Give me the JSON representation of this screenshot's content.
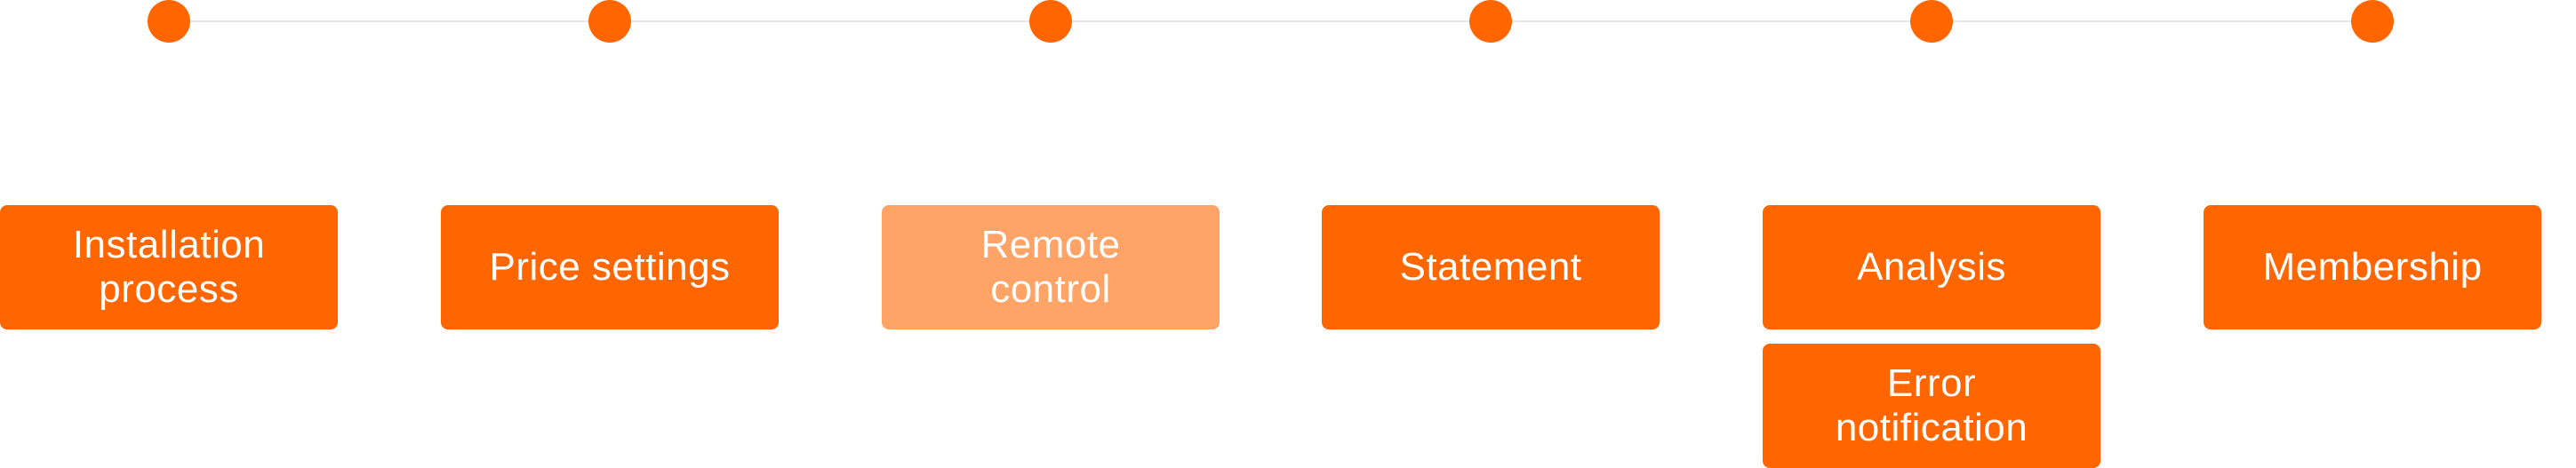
{
  "colors": {
    "accent": "#ff6600",
    "accent_muted": "#ffa366",
    "line": "#e6e6e6",
    "text": "#ffffff"
  },
  "steps": [
    {
      "label": "Installation\nprocess",
      "state": "active"
    },
    {
      "label": "Price settings",
      "state": "active"
    },
    {
      "label": "Remote\ncontrol",
      "state": "muted"
    },
    {
      "label": "Statement",
      "state": "active"
    },
    {
      "label": "Analysis",
      "state": "active",
      "extra": "Error\nnotification"
    },
    {
      "label": "Membership",
      "state": "active"
    }
  ]
}
